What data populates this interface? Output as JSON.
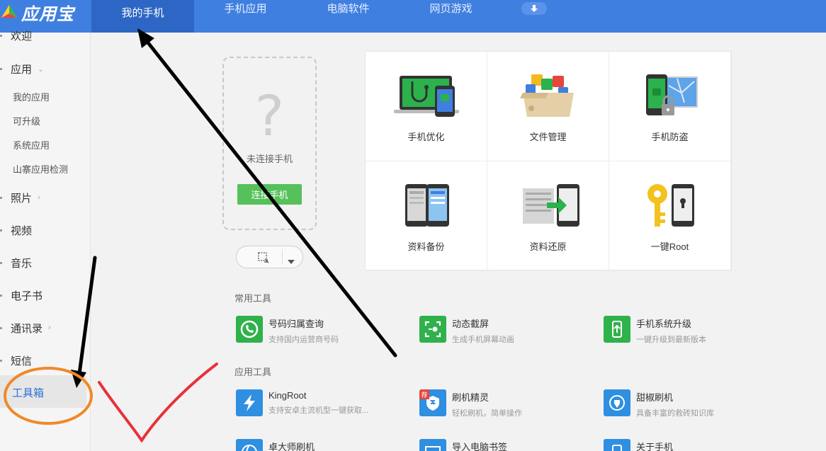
{
  "app": {
    "name": "应用宝"
  },
  "nav": {
    "tabs": [
      {
        "label": "我的手机"
      },
      {
        "label": "手机应用"
      },
      {
        "label": "电脑软件"
      },
      {
        "label": "网页游戏"
      }
    ]
  },
  "sidebar": {
    "items": [
      {
        "label": "欢迎"
      },
      {
        "label": "应用"
      },
      {
        "label": "照片"
      },
      {
        "label": "视频"
      },
      {
        "label": "音乐"
      },
      {
        "label": "电子书"
      },
      {
        "label": "通讯录"
      },
      {
        "label": "短信"
      },
      {
        "label": "工具箱"
      }
    ],
    "sub_items": [
      {
        "label": "我的应用"
      },
      {
        "label": "可升级"
      },
      {
        "label": "系统应用"
      },
      {
        "label": "山寨应用检测"
      }
    ]
  },
  "phone": {
    "question_mark": "?",
    "status": "未连接手机",
    "connect_label": "连接手机"
  },
  "features": [
    {
      "label": "手机优化"
    },
    {
      "label": "文件管理"
    },
    {
      "label": "手机防盗"
    },
    {
      "label": "资料备份"
    },
    {
      "label": "资料还原"
    },
    {
      "label": "一键Root"
    }
  ],
  "common_tools": {
    "title": "常用工具",
    "items": [
      {
        "name": "号码归属查询",
        "desc": "支持国内运营商号码"
      },
      {
        "name": "动态截屏",
        "desc": "生成手机屏幕动画"
      },
      {
        "name": "手机系统升级",
        "desc": "一键升级到最新版本"
      }
    ]
  },
  "app_tools": {
    "title": "应用工具",
    "items": [
      {
        "name": "KingRoot",
        "desc": "支持安卓主流机型一键获取..."
      },
      {
        "name": "刷机精灵",
        "desc": "轻松刷机，简单操作",
        "badge": "荐"
      },
      {
        "name": "甜椒刷机",
        "desc": "具备丰富的救砖知识库"
      },
      {
        "name": "卓大师刷机",
        "desc": ""
      },
      {
        "name": "导入电脑书签",
        "desc": ""
      },
      {
        "name": "关于手机",
        "desc": ""
      }
    ]
  },
  "colors": {
    "header": "#3f7fe0",
    "active_tab": "#2d66c4",
    "green_tool": "#2fb14b",
    "blue_tool": "#2f8fe0",
    "annotation_black": "#000000",
    "annotation_orange": "#f0892a",
    "annotation_red": "#e8313a"
  }
}
